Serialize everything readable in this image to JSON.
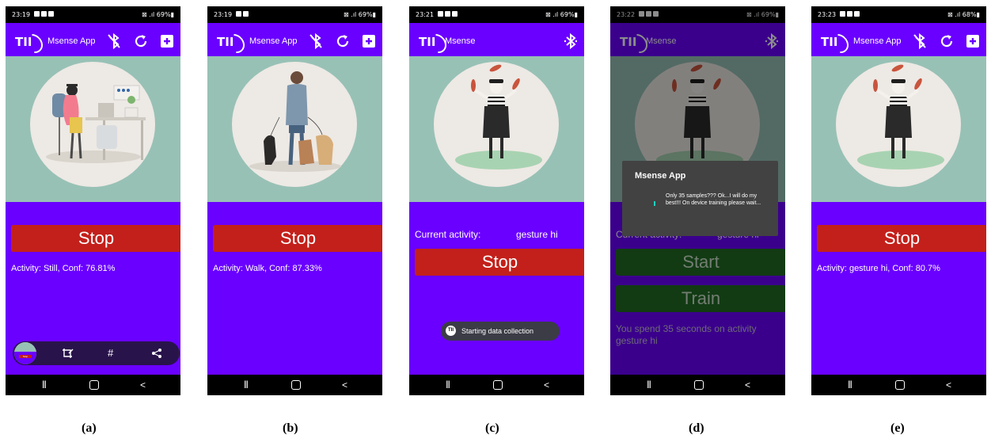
{
  "panels": [
    {
      "caption": "(a)",
      "status": {
        "time": "23:19",
        "right": "⊠ .ıl 69%▮"
      },
      "app_title": "Msense App",
      "stop_label": "Stop",
      "activity_text": "Activity: Still, Conf: 76.81%",
      "illustration": "person-sewing"
    },
    {
      "caption": "(b)",
      "status": {
        "time": "23:19",
        "right": "⊠ .ıl 69%▮"
      },
      "app_title": "Msense App",
      "stop_label": "Stop",
      "activity_text": "Activity: Walk, Conf: 87.33%",
      "illustration": "person-walking-dogs"
    },
    {
      "caption": "(c)",
      "status": {
        "time": "23:21",
        "right": "⊠ .ıl 69%▮"
      },
      "app_title": "Msense",
      "current_activity_label": "Current activity:",
      "current_activity_value": "gesture hi",
      "stop_label": "Stop",
      "toast": "Starting data collection",
      "toast_logo": "TII",
      "illustration": "mime-juggling"
    },
    {
      "caption": "(d)",
      "status": {
        "time": "23:22",
        "right": "⊠ .ıl 69%▮"
      },
      "app_title": "Msense",
      "dialog_title": "Msense App",
      "dialog_message": "Only 35 samples??? Ok...I will do my best!!! On device training please wait...",
      "current_activity_label": "Current activity:",
      "current_activity_value": "gesture hi",
      "start_label": "Start",
      "train_label": "Train",
      "spend_text": "You spend 35 seconds on activity gesture hi",
      "illustration": "mime-juggling"
    },
    {
      "caption": "(e)",
      "status": {
        "time": "23:23",
        "right": "⊠ .ıl 68%▮"
      },
      "app_title": "Msense App",
      "stop_label": "Stop",
      "activity_text": "Activity: gesture hi, Conf: 80.7%",
      "illustration": "mime-juggling"
    }
  ],
  "logo_text": "TII",
  "toolbar_a": {
    "hash": "#",
    "thumb_text": "Stop"
  },
  "colors": {
    "app_purple": "#6a00ff",
    "hero_teal": "#98c1b6",
    "stop_red": "#c3201b",
    "train_green": "#216c24"
  }
}
